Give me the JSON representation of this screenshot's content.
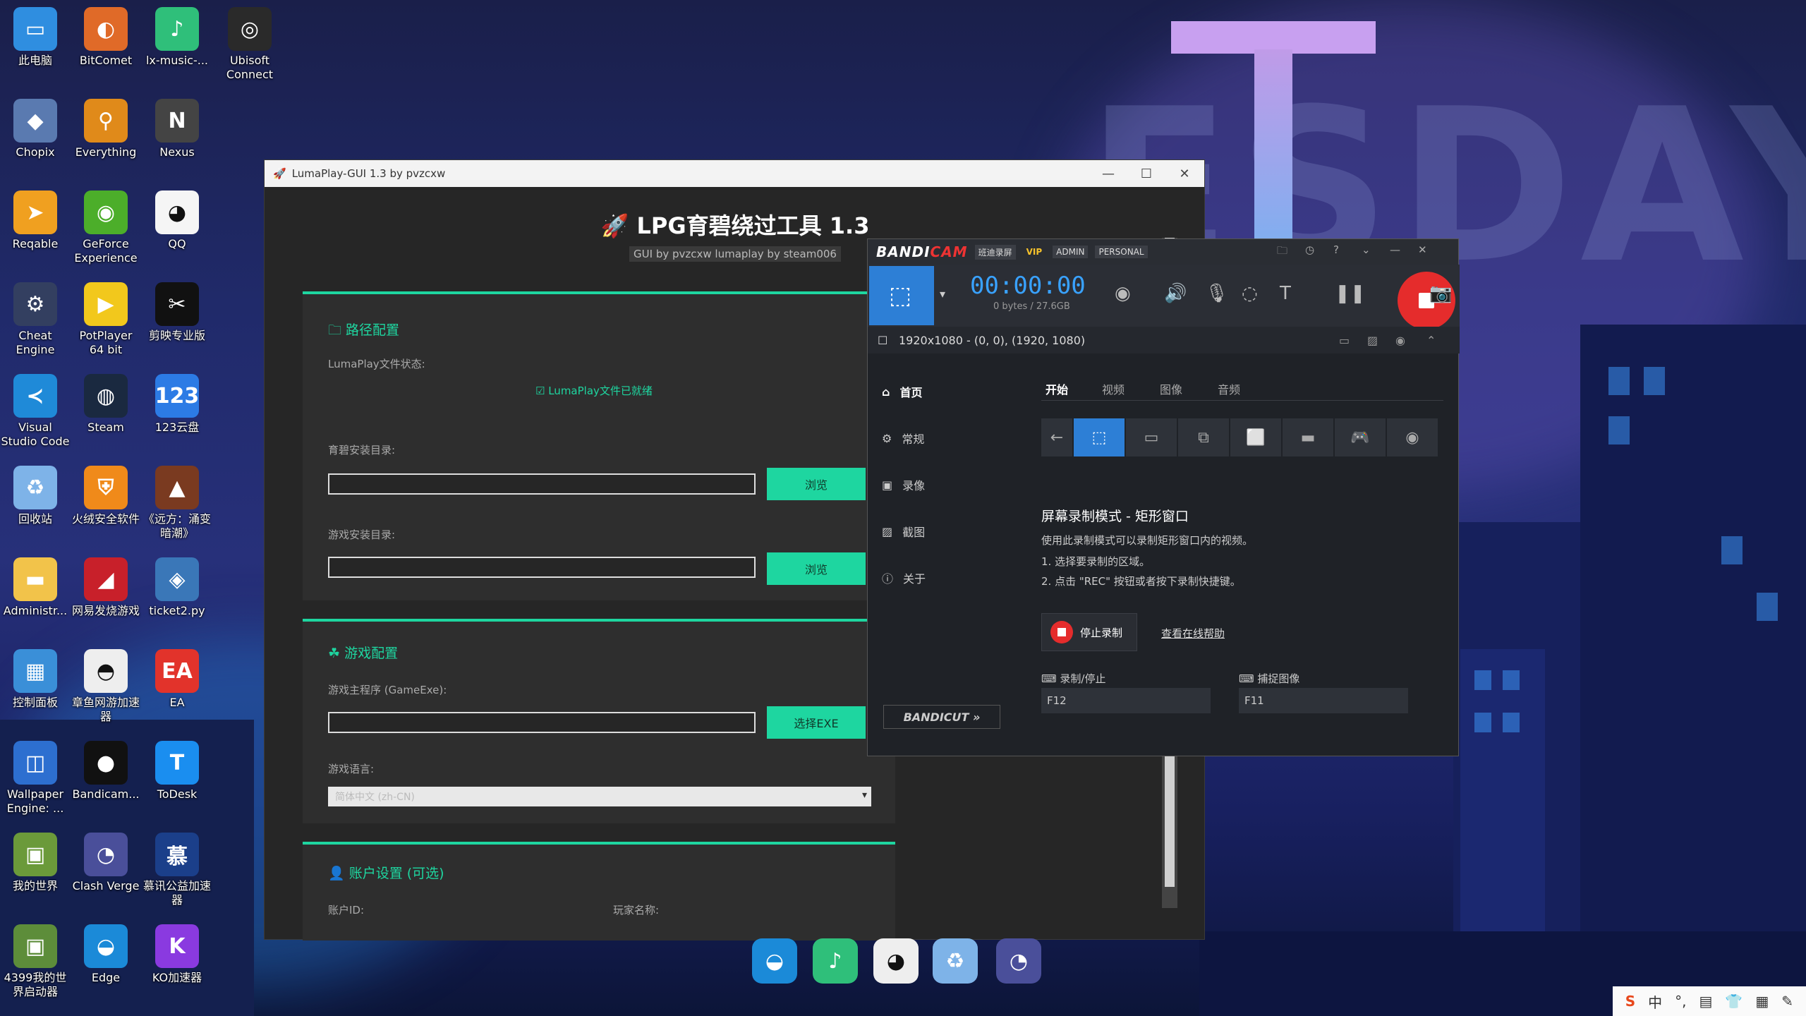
{
  "desktop_icons": [
    {
      "label": "此电脑",
      "glyph": "▭",
      "color": "#2f8ee0"
    },
    {
      "label": "BitComet",
      "glyph": "◐",
      "color": "#e06a28"
    },
    {
      "label": "lx-music-...",
      "glyph": "♪",
      "color": "#2fbf7a"
    },
    {
      "label": "Ubisoft Connect",
      "glyph": "◎",
      "color": "#2a2a2a"
    },
    {
      "label": "Chopix",
      "glyph": "◆",
      "color": "#5a7ab0"
    },
    {
      "label": "Everything",
      "glyph": "⚲",
      "color": "#e08a1a"
    },
    {
      "label": "Nexus",
      "glyph": "N",
      "color": "#444"
    },
    {
      "label": "Reqable",
      "glyph": "➤",
      "color": "#f0a020"
    },
    {
      "label": "GeForce Experience",
      "glyph": "◉",
      "color": "#4cae2a"
    },
    {
      "label": "QQ",
      "glyph": "◕",
      "color": "#f5f5f5"
    },
    {
      "label": "Cheat Engine",
      "glyph": "⚙",
      "color": "#333f60"
    },
    {
      "label": "PotPlayer 64 bit",
      "glyph": "▶",
      "color": "#f2c81c"
    },
    {
      "label": "剪映专业版",
      "glyph": "✂",
      "color": "#111"
    },
    {
      "label": "Visual Studio Code",
      "glyph": "≺",
      "color": "#1f8ad8"
    },
    {
      "label": "Steam",
      "glyph": "◍",
      "color": "#1a2940"
    },
    {
      "label": "123云盘",
      "glyph": "123",
      "color": "#2c7be5"
    },
    {
      "label": "回收站",
      "glyph": "♻",
      "color": "#7eb3e8"
    },
    {
      "label": "火绒安全软件",
      "glyph": "⛨",
      "color": "#f08a1a"
    },
    {
      "label": "《远方：涌变暗潮》",
      "glyph": "▲",
      "color": "#7a3a20"
    },
    {
      "label": "Administr...",
      "glyph": "▬",
      "color": "#f2c34a"
    },
    {
      "label": "网易发烧游戏",
      "glyph": "◢",
      "color": "#c8202a"
    },
    {
      "label": "ticket2.py",
      "glyph": "◈",
      "color": "#3a77b8"
    },
    {
      "label": "控制面板",
      "glyph": "▦",
      "color": "#3a8fd8"
    },
    {
      "label": "章鱼网游加速器",
      "glyph": "◓",
      "color": "#eee"
    },
    {
      "label": "EA",
      "glyph": "EA",
      "color": "#e2332b"
    },
    {
      "label": "Wallpaper Engine: ...",
      "glyph": "◫",
      "color": "#2d6fd0"
    },
    {
      "label": "Bandicam...",
      "glyph": "●",
      "color": "#111"
    },
    {
      "label": "ToDesk",
      "glyph": "T",
      "color": "#1a8ef0"
    },
    {
      "label": "我的世界",
      "glyph": "▣",
      "color": "#6b9a3a"
    },
    {
      "label": "Clash Verge",
      "glyph": "◔",
      "color": "#4a4f9a"
    },
    {
      "label": "慕讯公益加速器",
      "glyph": "慕",
      "color": "#1b3f8a"
    },
    {
      "label": "4399我的世界启动器",
      "glyph": "▣",
      "color": "#5d8d3a"
    },
    {
      "label": "Edge",
      "glyph": "◒",
      "color": "#1b8ad8"
    },
    {
      "label": "KO加速器",
      "glyph": "K",
      "color": "#8a3ae0"
    }
  ],
  "luma": {
    "window_title": "LumaPlay-GUI 1.3 by pvzcxw",
    "heading": "LPG育碧绕过工具 1.3",
    "subheading": "GUI by pvzcxw lumaplay by steam006",
    "path_section": {
      "title": "路径配置",
      "status_label": "LumaPlay文件状态:",
      "status_value": "LumaPlay文件已就绪",
      "ubi_dir_label": "育碧安装目录:",
      "game_dir_label": "游戏安装目录:",
      "browse_label": "浏览"
    },
    "game_section": {
      "title": "游戏配置",
      "exe_label": "游戏主程序 (GameExe):",
      "select_exe_label": "选择EXE",
      "lang_label": "游戏语言:",
      "lang_value": "简体中文 (zh-CN)"
    },
    "account_section": {
      "title": "账户设置 (可选)",
      "account_id_label": "账户ID:",
      "player_name_label": "玩家名称:"
    }
  },
  "bandicam": {
    "logo_left": "BANDI",
    "logo_right": "CAM",
    "brand_cn": "班迪录屏",
    "tag_vip": "VIP",
    "tag_admin": "ADMIN",
    "tag_personal": "PERSONAL",
    "timer": "00:00:00",
    "bytes": "0 bytes / 27.6GB",
    "area_info": "1920x1080 - (0, 0), (1920, 1080)",
    "nav": [
      "首页",
      "常规",
      "录像",
      "截图",
      "关于"
    ],
    "tabs": [
      "开始",
      "视频",
      "图像",
      "音频"
    ],
    "mode_heading": "屏幕录制模式 - 矩形窗口",
    "mode_desc": "使用此录制模式可以录制矩形窗口内的视频。",
    "step1": "1. 选择要录制的区域。",
    "step2": "2. 点击 \"REC\" 按钮或者按下录制快捷键。",
    "stop_label": "停止录制",
    "help_label": "查看在线帮助",
    "hk_record_label": "录制/停止",
    "hk_record_value": "F12",
    "hk_capture_label": "捕捉图像",
    "hk_capture_value": "F11",
    "bandicut_label": "BANDICUT"
  },
  "wallpaper": {
    "text": "ESDAY"
  },
  "tray": {
    "ime": "中"
  }
}
